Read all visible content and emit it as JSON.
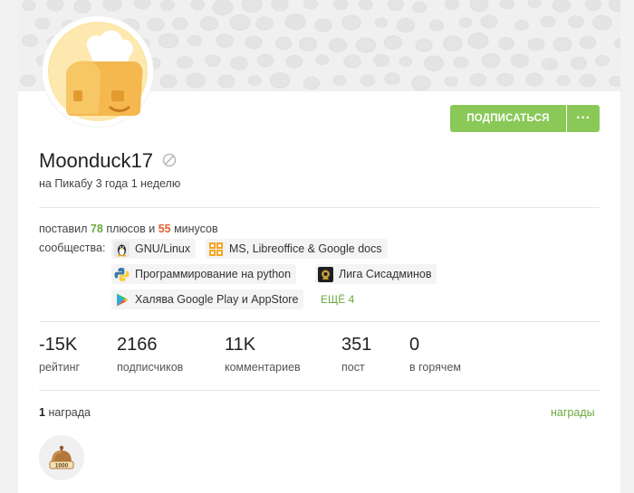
{
  "profile": {
    "username": "Moonduck17",
    "since": "на Пикабу 3 года 1 неделю",
    "subscribe_label": "ПОДПИСАТЬСЯ",
    "more_label": "···"
  },
  "votes": {
    "prefix": "поставил",
    "plus_count": "78",
    "mid": "плюсов и",
    "minus_count": "55",
    "suffix": "минусов"
  },
  "communities": {
    "label": "сообщества:",
    "items": [
      {
        "name": "GNU/Linux",
        "icon": "penguin-icon"
      },
      {
        "name": "MS, Libreoffice & Google docs",
        "icon": "office-icon"
      },
      {
        "name": "Программирование на python",
        "icon": "python-icon"
      },
      {
        "name": "Лига Сисадминов",
        "icon": "sysadmin-icon"
      },
      {
        "name": "Халява Google Play и AppStore",
        "icon": "play-icon"
      }
    ],
    "more": "ЕЩЁ 4"
  },
  "stats": [
    {
      "value": "-15K",
      "label": "рейтинг"
    },
    {
      "value": "2166",
      "label": "подписчиков"
    },
    {
      "value": "11K",
      "label": "комментариев"
    },
    {
      "value": "351",
      "label": "пост"
    },
    {
      "value": "0",
      "label": "в горячем"
    }
  ],
  "awards": {
    "count": "1",
    "count_label": "награда",
    "link": "награды",
    "items": [
      {
        "icon": "bell-award-icon",
        "badge": "1000"
      }
    ]
  },
  "colors": {
    "accent_green": "#8ac858",
    "plus_green": "#6ea83d",
    "minus_orange": "#e0612e"
  }
}
